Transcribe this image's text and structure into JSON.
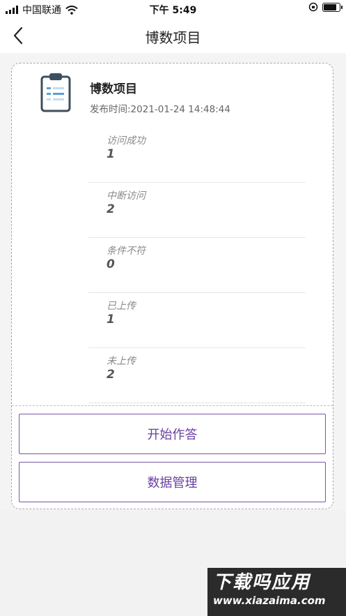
{
  "status_bar": {
    "carrier": "中国联通",
    "time": "下午 5:49"
  },
  "nav": {
    "title": "博数项目"
  },
  "project": {
    "title": "博数项目",
    "publish_time": "发布时间:2021-01-24 14:48:44",
    "icon": "clipboard-icon"
  },
  "stats": [
    {
      "label": "访问成功",
      "value": "1"
    },
    {
      "label": "中断访问",
      "value": "2"
    },
    {
      "label": "条件不符",
      "value": "0"
    },
    {
      "label": "已上传",
      "value": "1"
    },
    {
      "label": "未上传",
      "value": "2"
    }
  ],
  "buttons": {
    "start": "开始作答",
    "data": "数据管理"
  },
  "watermark": {
    "title": "下载吗应用",
    "url": "www.xiazaima.com"
  },
  "colors": {
    "accent": "#6a3fa0",
    "icon_dark": "#3d4f5c",
    "icon_blue": "#5aa0d8"
  }
}
